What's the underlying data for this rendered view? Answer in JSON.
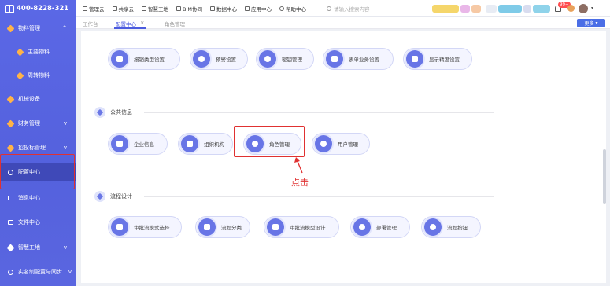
{
  "brand": {
    "phone": "400-8228-321"
  },
  "sidebar": {
    "items": [
      {
        "label": "物料管理",
        "chevron": "^"
      },
      {
        "label": "主要物料"
      },
      {
        "label": "周转物料"
      },
      {
        "label": "机械设备"
      },
      {
        "label": "财务管理",
        "chevron": "v"
      },
      {
        "label": "招投标管理",
        "chevron": "v"
      },
      {
        "label": "配置中心"
      },
      {
        "label": "消息中心"
      },
      {
        "label": "文件中心"
      },
      {
        "label": "智慧工地",
        "chevron": "v"
      },
      {
        "label": "实名制配置与同步",
        "chevron": "v"
      }
    ]
  },
  "topnav": {
    "items": [
      "管理云",
      "共享云",
      "智慧工地",
      "BIM协同",
      "数据中心",
      "应用中心",
      "帮助中心"
    ],
    "search_placeholder": "请输入搜索内容",
    "notification_badge": "99+"
  },
  "tabs": {
    "items": [
      "工作台",
      "配置中心",
      "角色管理"
    ],
    "close": "×",
    "more_label": "更多"
  },
  "sections": {
    "top_buttons": [
      "报销类型设置",
      "预警设置",
      "密钥管理",
      "表单业务设置",
      "显示精度设置"
    ],
    "public_info": {
      "title": "公共信息",
      "buttons": [
        "企业信息",
        "组织机构",
        "角色管理",
        "用户管理"
      ]
    },
    "workflow": {
      "title": "流程设计",
      "buttons": [
        "审批流模式选择",
        "流程分类",
        "审批流模型设计",
        "部署管理",
        "流程按钮"
      ]
    }
  },
  "annotation": {
    "click_label": "点击",
    "color": "#e03131"
  },
  "colors": {
    "sidebar": "#5b68e6",
    "accent": "#4b5bdf",
    "active_nav": "#3f49b8"
  }
}
